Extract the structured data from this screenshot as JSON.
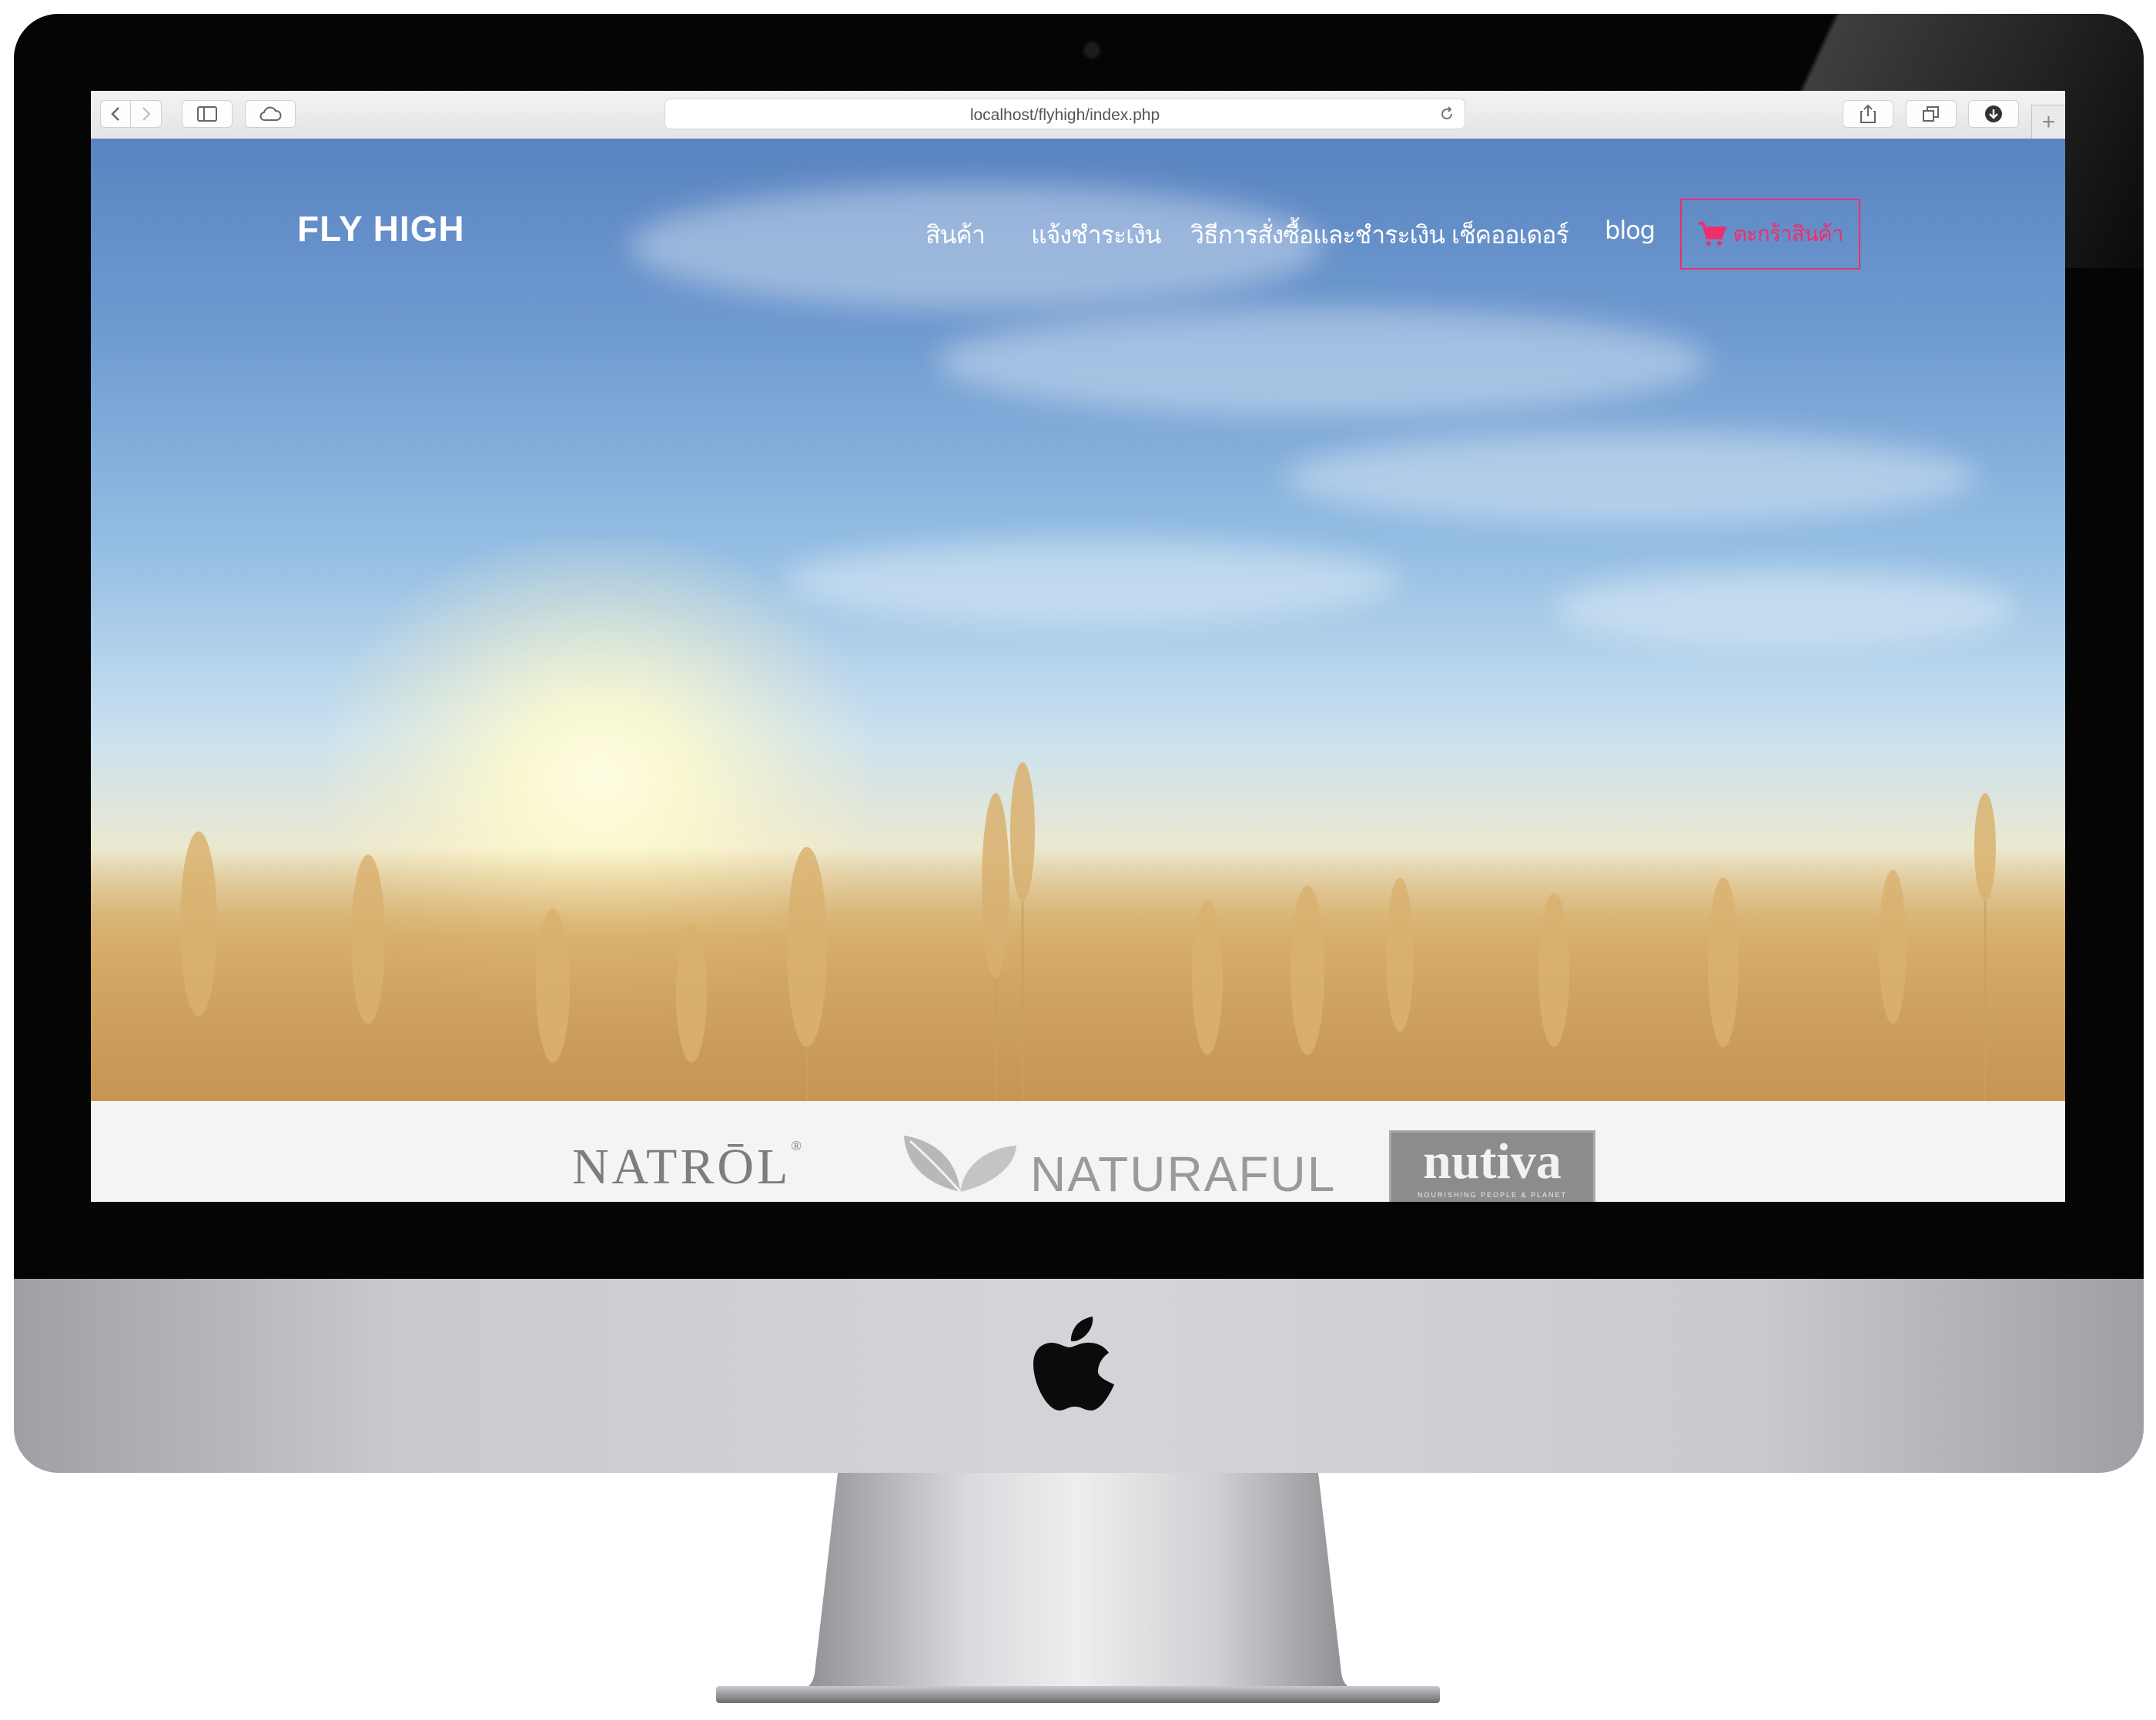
{
  "browser": {
    "url": "localhost/flyhigh/index.php",
    "buttons": [
      "back-icon",
      "forward-icon",
      "sidebar-icon",
      "icloud-icon",
      "share-icon",
      "tabs-icon",
      "download-icon",
      "reload-icon",
      "new-tab-icon"
    ],
    "new_tab_glyph": "+"
  },
  "site": {
    "logo": "FLY HIGH",
    "nav": [
      {
        "label": "สินค้า"
      },
      {
        "label": "แจ้งชำระเงิน"
      },
      {
        "label": "วิธีการสั่งซื้อและชำระเงิน"
      },
      {
        "label": "เช็คออเดอร์"
      },
      {
        "label": "blog"
      }
    ],
    "cart": {
      "label": "ตะกร้าสินค้า",
      "icon": "cart-icon",
      "color": "#e8306a"
    }
  },
  "brands": {
    "natrol": "NATRŌL",
    "natrol_mark": "®",
    "naturaful": "NATURAFUL",
    "nutiva": "nutiva",
    "nutiva_tagline": "NOURISHING PEOPLE & PLANET"
  },
  "device": {
    "logo": "apple-logo"
  }
}
